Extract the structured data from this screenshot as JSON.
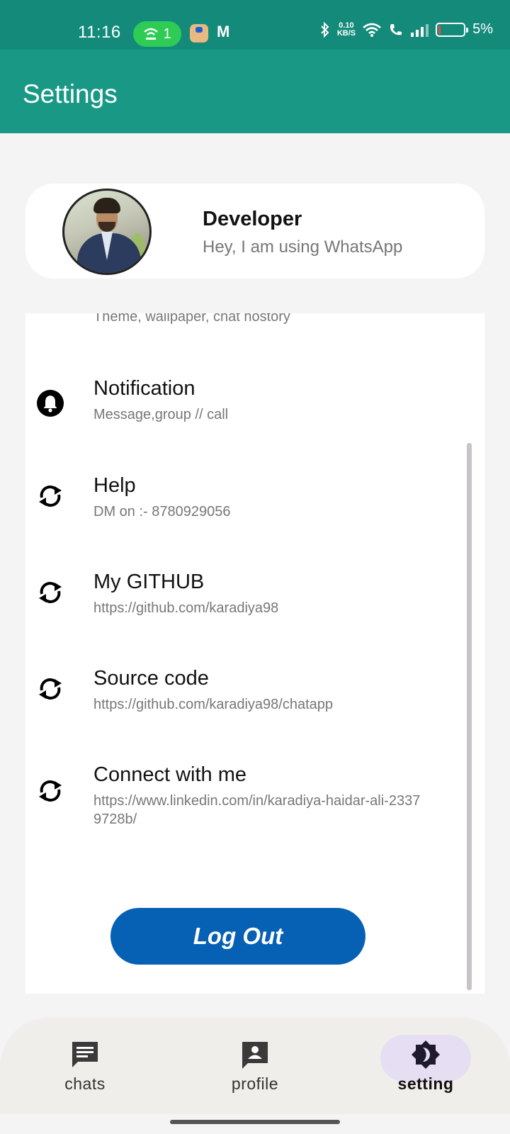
{
  "status_bar": {
    "time": "11:16",
    "hotspot_count": "1",
    "gmail_glyph": "M",
    "net_speed_value": "0.10",
    "net_speed_unit": "KB/S",
    "battery": "5%"
  },
  "app_bar": {
    "title": "Settings"
  },
  "profile": {
    "name": "Developer",
    "status": "Hey, I am using WhatsApp"
  },
  "settings": {
    "items": [
      {
        "title": "",
        "subtitle": "Theme, wallpaper, chat hostory",
        "icon": "chat-icon"
      },
      {
        "title": "Notification",
        "subtitle": "Message,group // call",
        "icon": "bell-icon"
      },
      {
        "title": "Help",
        "subtitle": "DM on :- 8780929056",
        "icon": "sync-icon"
      },
      {
        "title": "My GITHUB",
        "subtitle": "https://github.com/karadiya98",
        "icon": "sync-icon"
      },
      {
        "title": "Source code",
        "subtitle": "https://github.com/karadiya98/chatapp",
        "icon": "sync-icon"
      },
      {
        "title": "Connect with me",
        "subtitle": "https://www.linkedin.com/in/karadiya-haidar-ali-23379728b/",
        "icon": "sync-icon"
      }
    ],
    "logout_label": "Log Out"
  },
  "bottom_nav": {
    "items": [
      {
        "label": "chats",
        "icon": "chat-bubble-icon"
      },
      {
        "label": "profile",
        "icon": "profile-icon"
      },
      {
        "label": "setting",
        "icon": "brightness-icon",
        "active": true
      }
    ]
  },
  "colors": {
    "status_bar": "#148a7b",
    "app_bar": "#199886",
    "logout_button": "#0660b4",
    "nav_active": "#e6dff3"
  }
}
